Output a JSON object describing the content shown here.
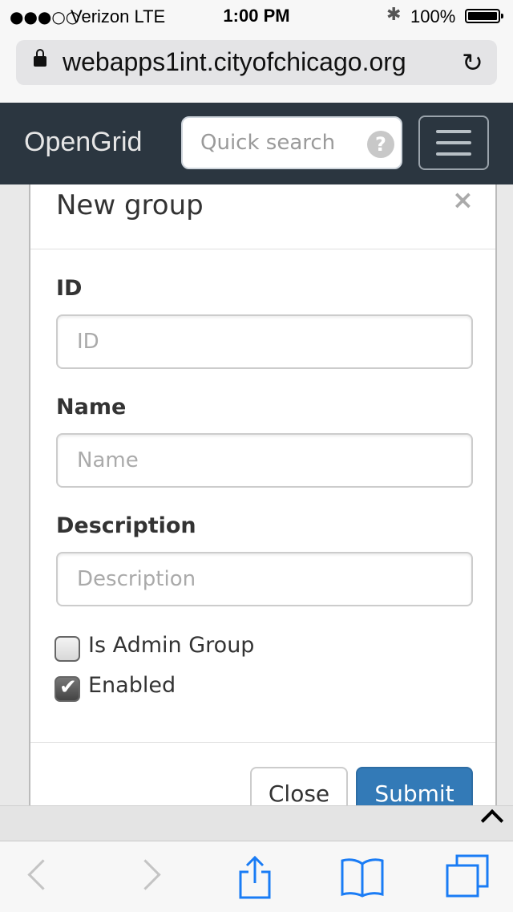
{
  "status_bar": {
    "signal": "●●●○○",
    "carrier": "Verizon  LTE",
    "time": "1:00 PM",
    "battery": "100%"
  },
  "browser": {
    "url": "webapps1int.cityofchicago.org"
  },
  "navbar": {
    "brand": "OpenGrid",
    "search_placeholder": "Quick search",
    "help_glyph": "?"
  },
  "modal": {
    "title": "New group",
    "close_glyph": "×",
    "fields": {
      "id_label": "ID",
      "id_placeholder": "ID",
      "name_label": "Name",
      "name_placeholder": "Name",
      "description_label": "Description",
      "description_placeholder": "Description"
    },
    "checkboxes": {
      "admin_label": "Is Admin Group",
      "admin_checked": false,
      "enabled_label": "Enabled",
      "enabled_checked": true
    },
    "buttons": {
      "close": "Close",
      "submit": "Submit"
    }
  },
  "colors": {
    "navbar": "#2b3640",
    "primary": "#337ab7"
  }
}
